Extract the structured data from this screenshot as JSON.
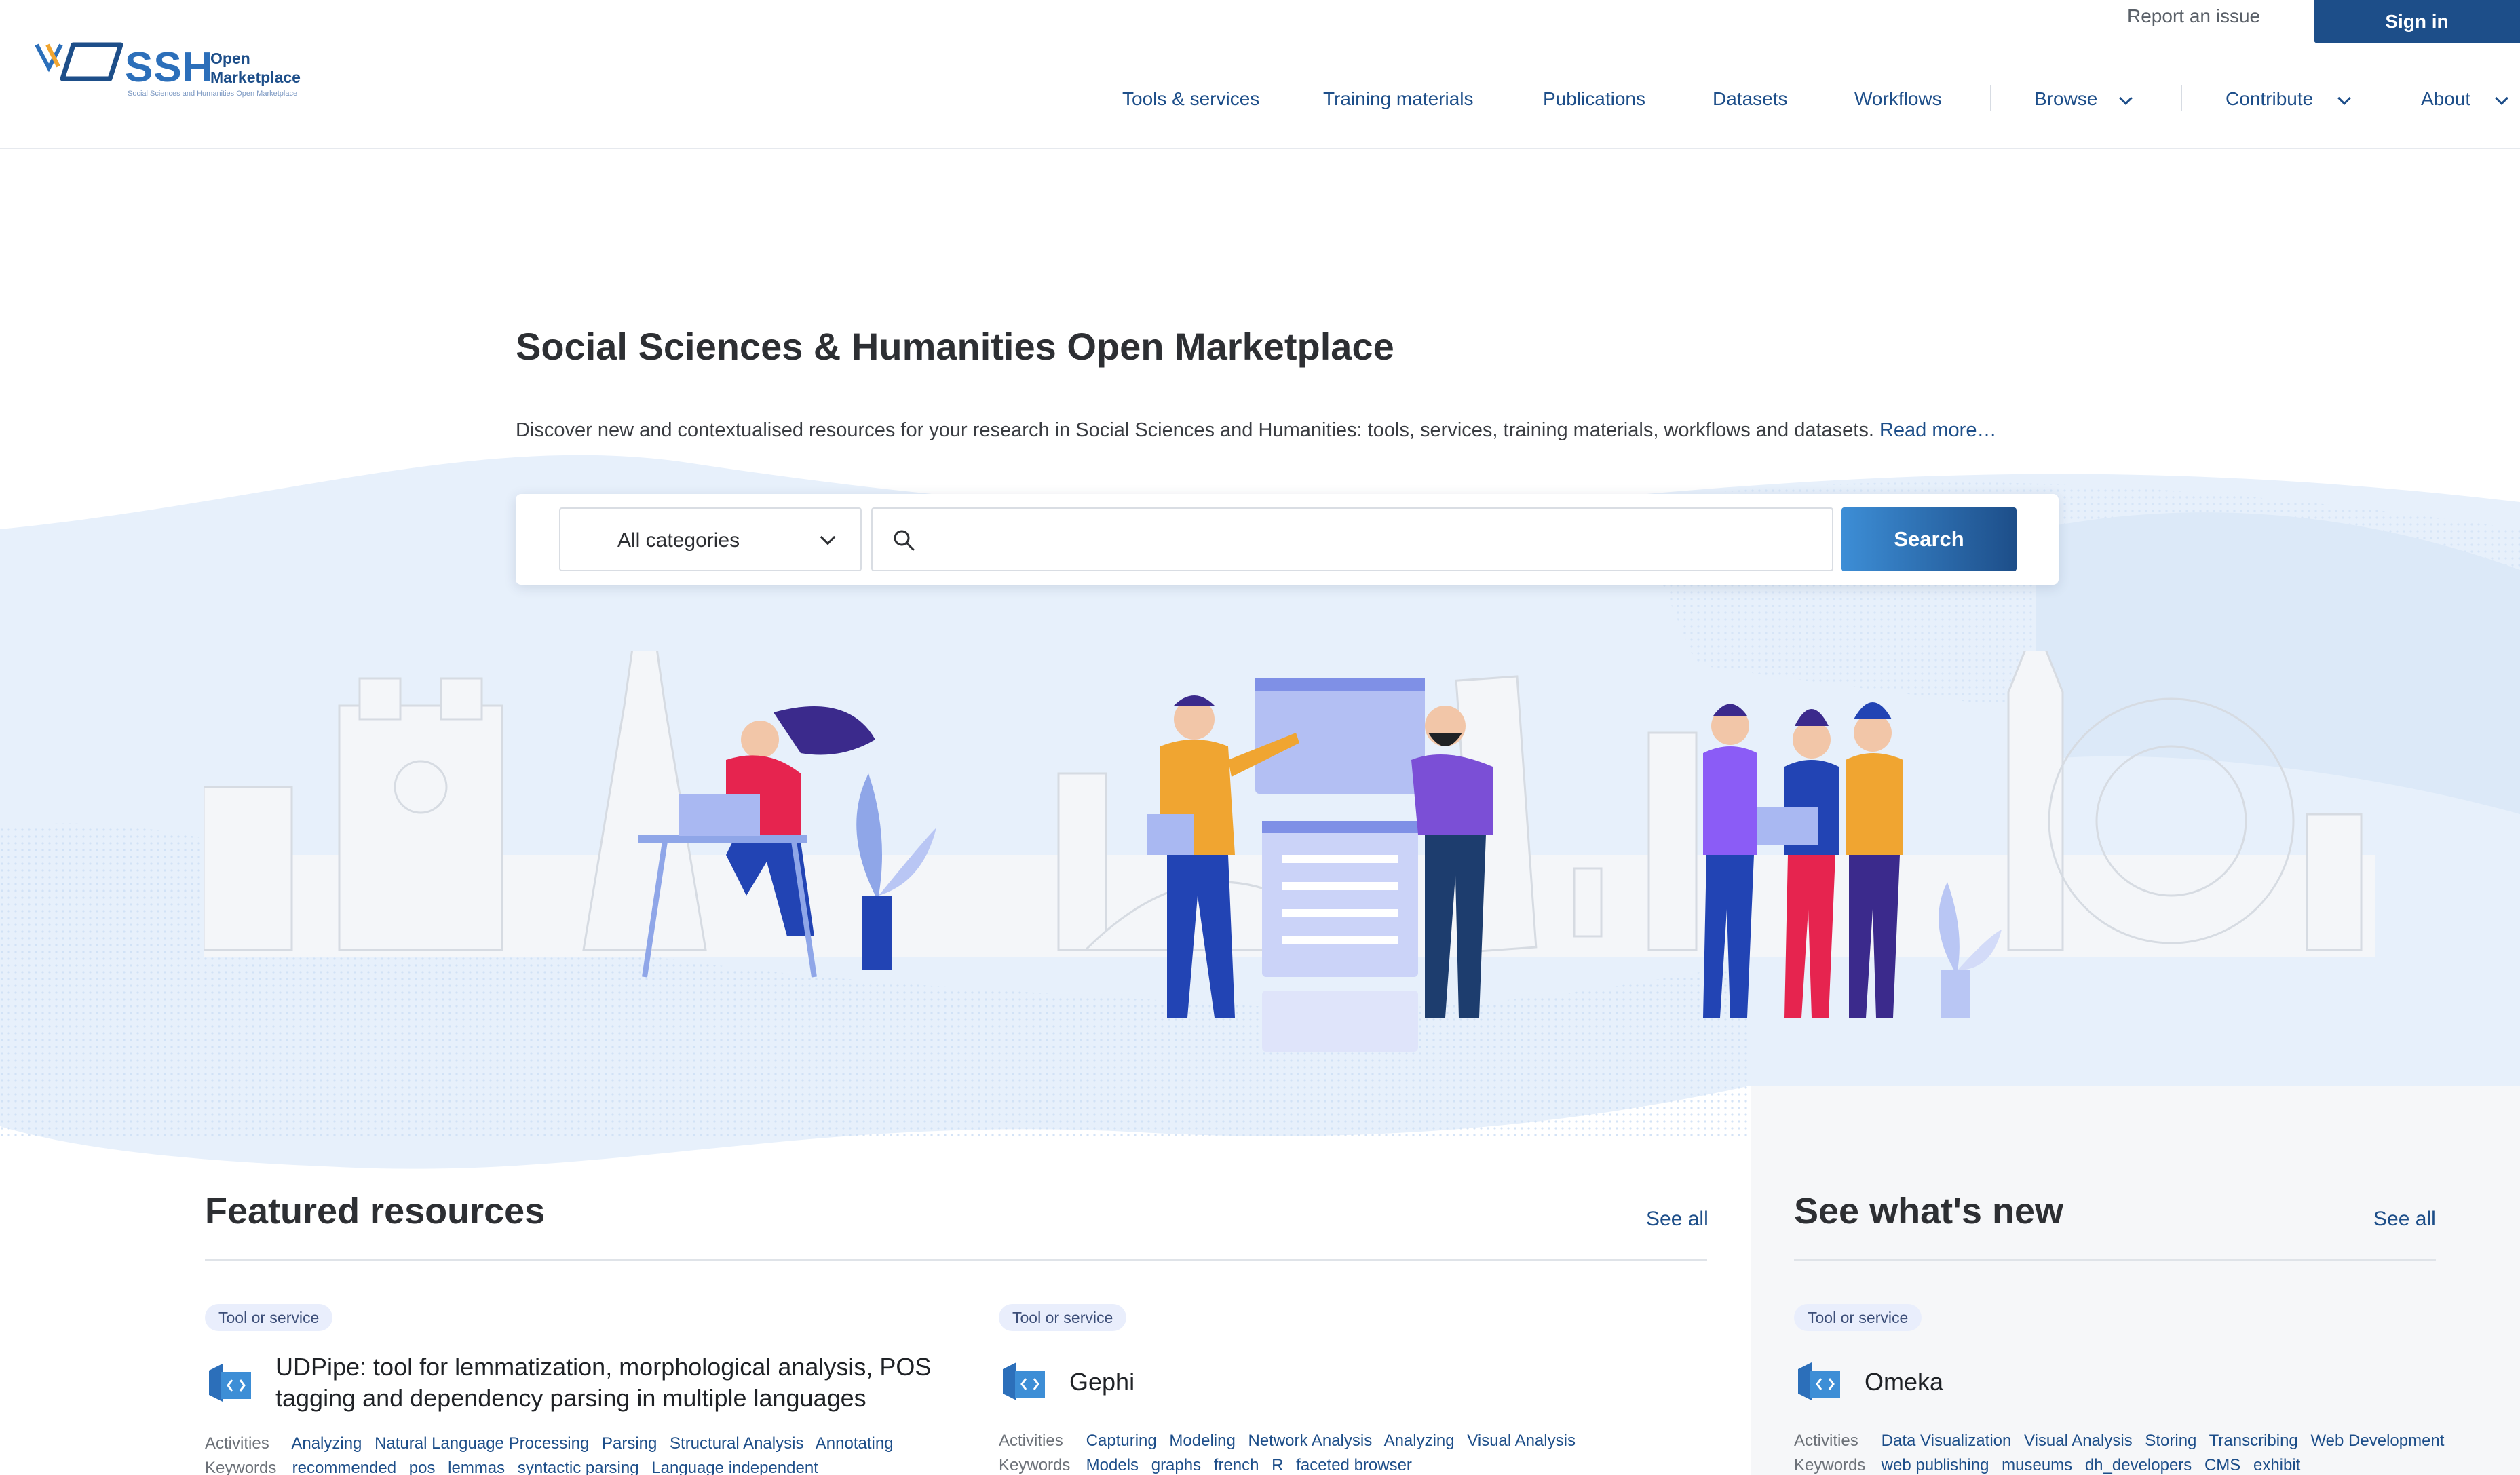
{
  "header": {
    "logo": {
      "ssh": "SSH",
      "open": "Open",
      "marketplace": "Marketplace",
      "subtitle": "Social Sciences and Humanities Open Marketplace"
    },
    "report_issue": "Report an issue",
    "sign_in": "Sign in",
    "nav": {
      "tools": "Tools & services",
      "training": "Training materials",
      "publications": "Publications",
      "datasets": "Datasets",
      "workflows": "Workflows",
      "browse": "Browse",
      "contribute": "Contribute",
      "about": "About"
    }
  },
  "hero": {
    "title": "Social Sciences & Humanities Open Marketplace",
    "description": "Discover new and contextualised resources for your research in Social Sciences and Humanities: tools, services, training materials, workflows and datasets.",
    "read_more": "Read more…",
    "search": {
      "category": "All categories",
      "input_value": "",
      "button": "Search"
    }
  },
  "featured": {
    "title": "Featured resources",
    "see_all": "See all",
    "items": [
      {
        "badge": "Tool or service",
        "title": "UDPipe: tool for lemmatization, morphological analysis, POS tagging and dependency parsing in multiple languages",
        "activities_label": "Activities",
        "activities": [
          "Analyzing",
          "Natural Language Processing",
          "Parsing",
          "Structural Analysis",
          "Annotating"
        ],
        "keywords_label": "Keywords",
        "keywords": [
          "recommended",
          "pos",
          "lemmas",
          "syntactic parsing",
          "Language independent"
        ]
      },
      {
        "badge": "Tool or service",
        "title": "Gephi",
        "activities_label": "Activities",
        "activities": [
          "Capturing",
          "Modeling",
          "Network Analysis",
          "Analyzing",
          "Visual Analysis"
        ],
        "keywords_label": "Keywords",
        "keywords": [
          "Models",
          "graphs",
          "french",
          "R",
          "faceted browser"
        ]
      }
    ]
  },
  "whats_new": {
    "title": "See what's new",
    "see_all": "See all",
    "items": [
      {
        "badge": "Tool or service",
        "title": "Omeka",
        "activities_label": "Activities",
        "activities": [
          "Data Visualization",
          "Visual Analysis",
          "Storing",
          "Transcribing",
          "Web Development"
        ],
        "keywords_label": "Keywords",
        "keywords": [
          "web publishing",
          "museums",
          "dh_developers",
          "CMS",
          "exhibit"
        ]
      }
    ]
  },
  "colors": {
    "brand": "#1d4e89",
    "accent": "#3d8ed6",
    "badge_bg": "#e9eefc",
    "hero_wash": "#e3eefb"
  },
  "icons": {
    "search": "search-icon",
    "chevron": "chevron-down-icon",
    "resource": "tool-or-service-icon"
  }
}
